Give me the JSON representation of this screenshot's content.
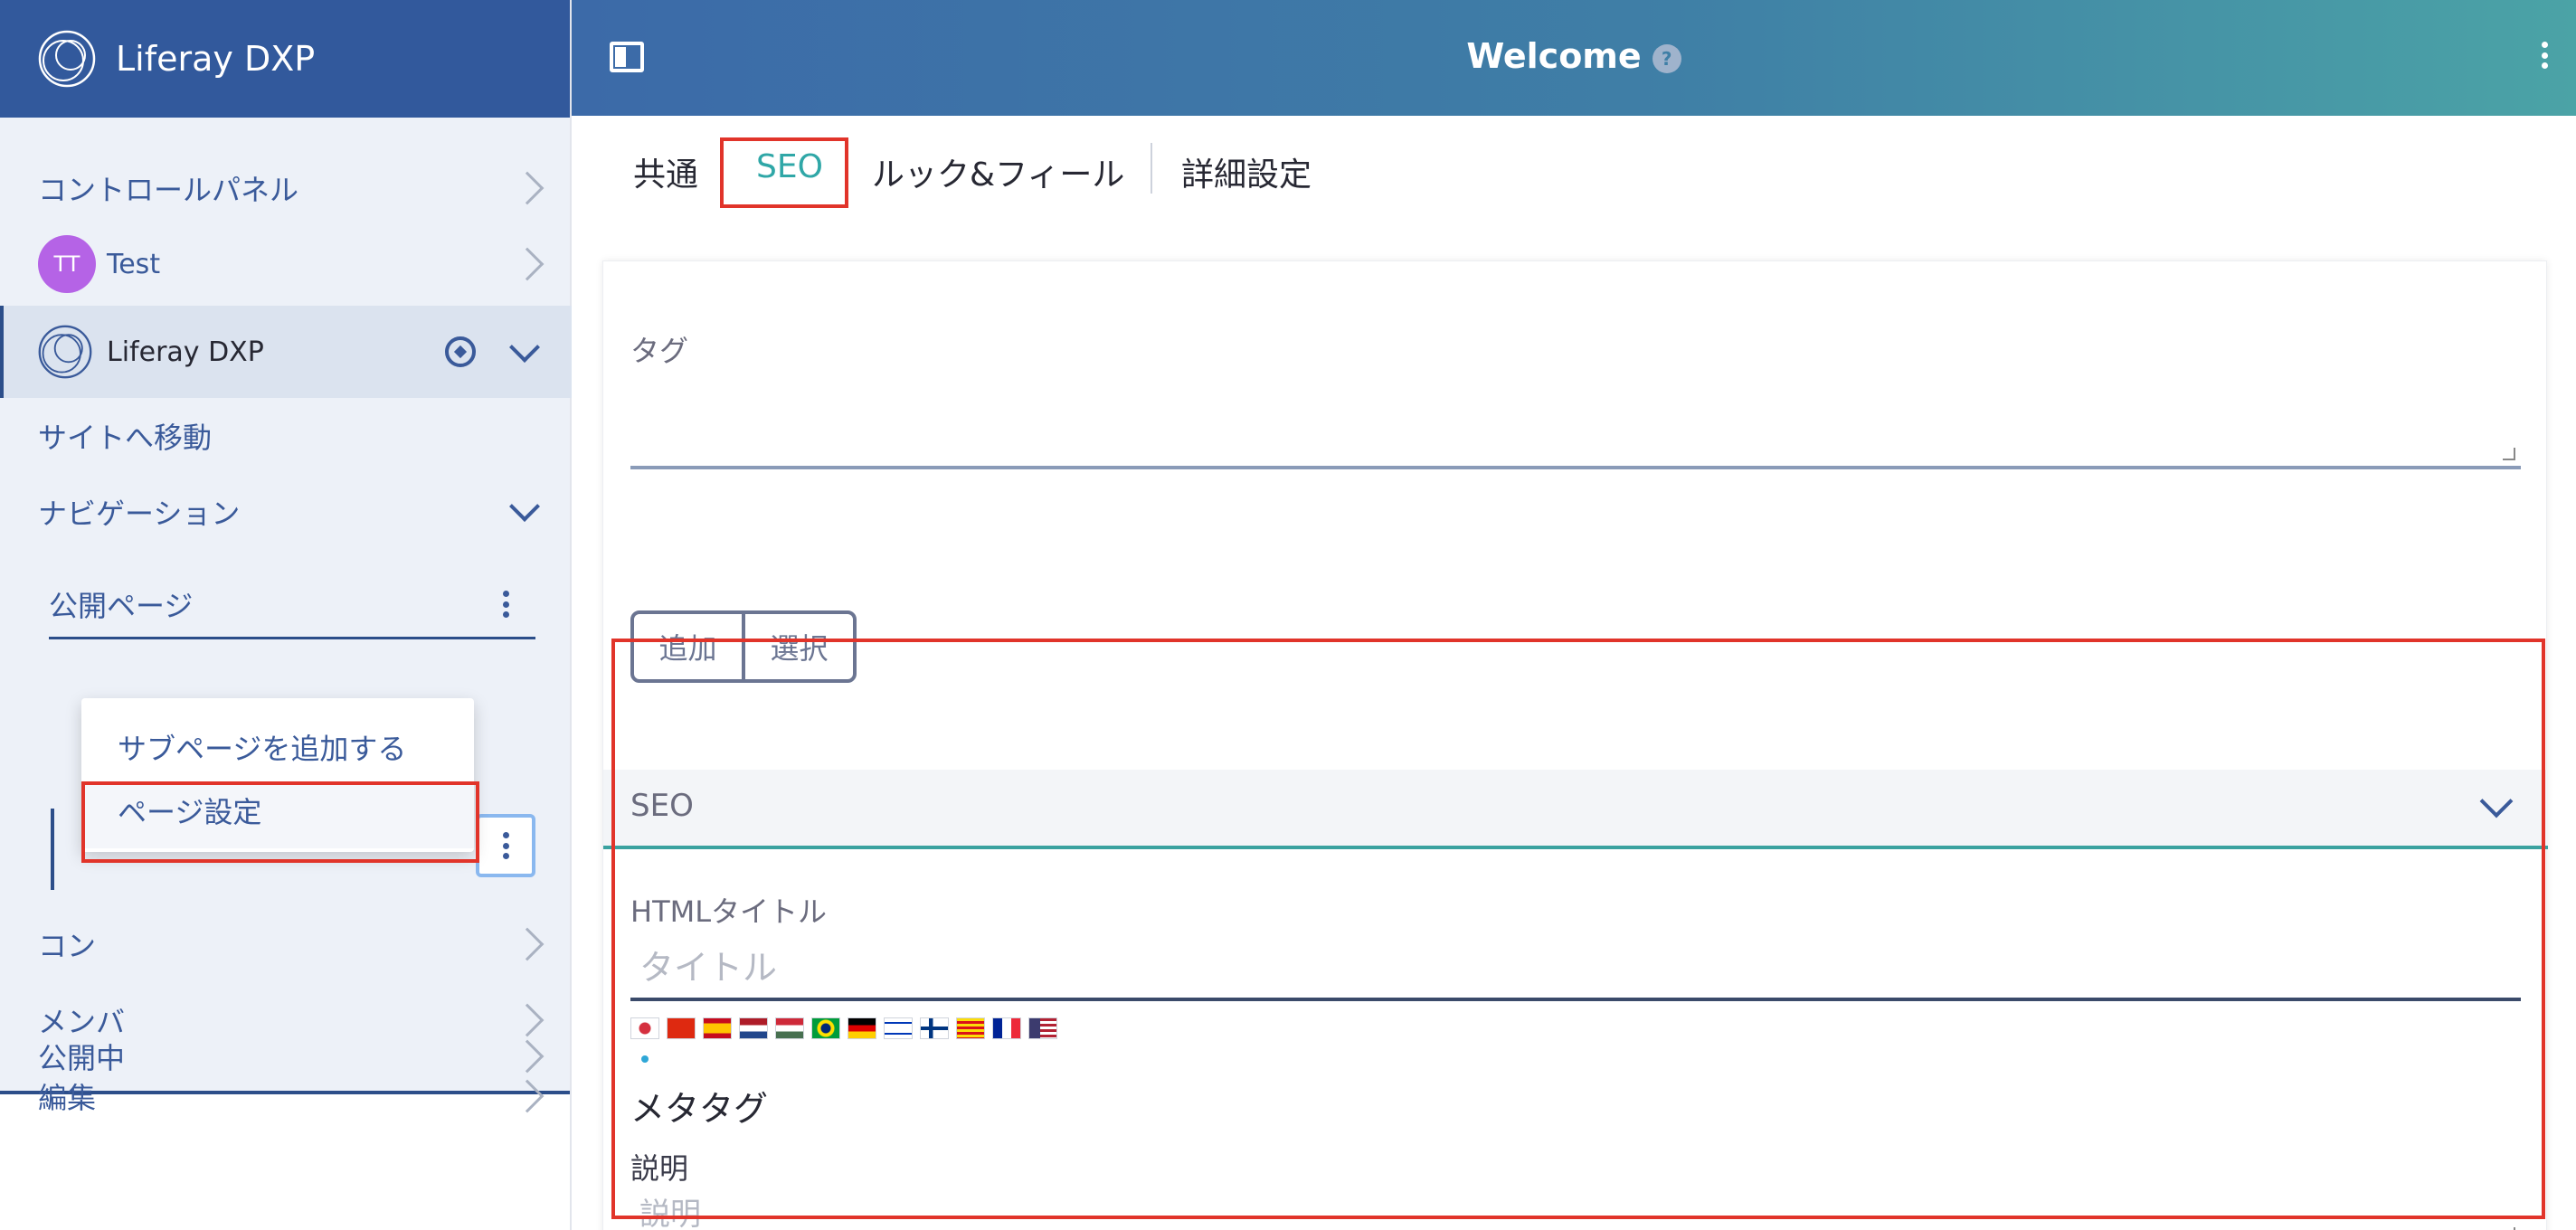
{
  "sidebar": {
    "brand": "Liferay DXP",
    "control_panel": "コントロールパネル",
    "user": {
      "initials": "TT",
      "name": "Test"
    },
    "site": {
      "name": "Liferay DXP"
    },
    "goto_site": "サイトへ移動",
    "navigation": "ナビゲーション",
    "public_pages": "公開ページ",
    "dropdown": {
      "add_subpage": "サブページを追加する",
      "page_settings": "ページ設定"
    },
    "content_partial": "コン",
    "members": "メンバ",
    "edit": "編集",
    "publishing": "公開中"
  },
  "topbar": {
    "title": "Welcome",
    "help": "?"
  },
  "tabs": [
    {
      "label": "共通"
    },
    {
      "label": "SEO"
    },
    {
      "label": "ルック&フィール"
    },
    {
      "label": "詳細設定"
    }
  ],
  "form": {
    "tags_label": "タグ",
    "add_button": "追加",
    "select_button": "選択",
    "seo_panel_title": "SEO",
    "html_title_label": "HTMLタイトル",
    "html_title_placeholder": "タイトル",
    "meta_tags_title": "メタタグ",
    "description_label": "説明",
    "description_placeholder": "説明"
  },
  "colors": {
    "sidebar_header": "#32599c",
    "accent_teal": "#2fa7a7",
    "highlight_red": "#e1342a",
    "avatar": "#b563e6"
  },
  "language_flags": [
    "jp",
    "cn",
    "es",
    "nl",
    "hu",
    "br",
    "de",
    "il",
    "fi",
    "ca",
    "fr",
    "us"
  ]
}
